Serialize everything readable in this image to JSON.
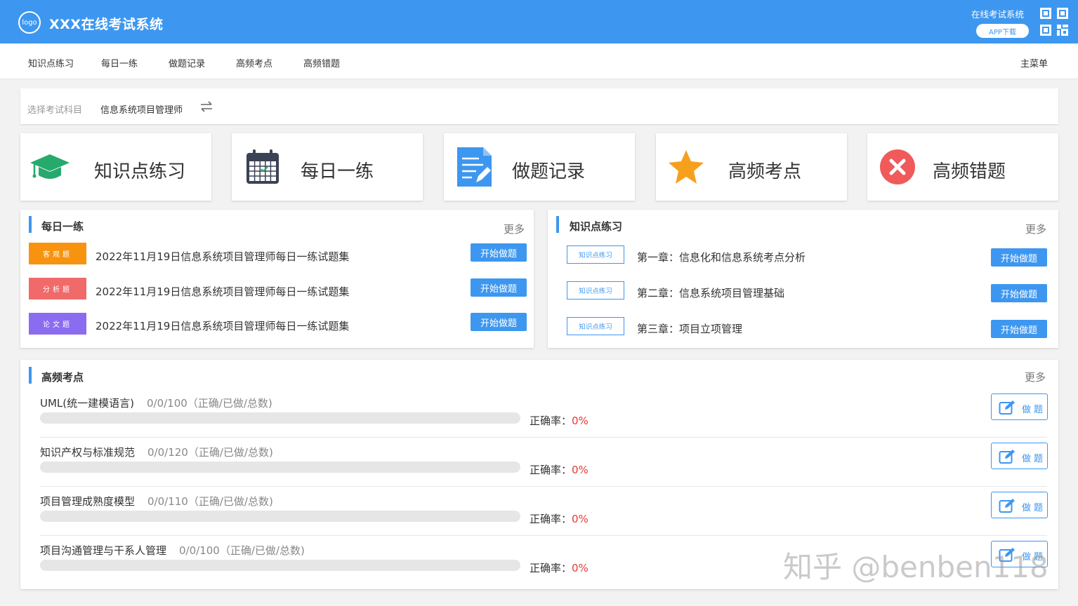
{
  "header": {
    "logo_text": "logo",
    "title": "XXX在线考试系统",
    "system_label": "在线考试系统",
    "app_download": "APP下载",
    "colors": {
      "primary": "#3d97f0",
      "white": "#ffffff"
    }
  },
  "nav": {
    "items": [
      "知识点练习",
      "每日一练",
      "做题记录",
      "高频考点",
      "高频错题"
    ],
    "main_menu": "主菜单"
  },
  "subject": {
    "label": "选择考试科目",
    "value": "信息系统项目管理师",
    "swap_icon": "swap-icon"
  },
  "tiles": [
    {
      "label": "知识点练习",
      "icon": "graduation-cap-icon",
      "color": "#26a96c"
    },
    {
      "label": "每日一练",
      "icon": "calendar-icon",
      "color": "#3a4256"
    },
    {
      "label": "做题记录",
      "icon": "document-edit-icon",
      "color": "#3d97f0"
    },
    {
      "label": "高频考点",
      "icon": "star-icon",
      "color": "#f7a01e"
    },
    {
      "label": "高频错题",
      "icon": "error-circle-icon",
      "color": "#f05a5a"
    }
  ],
  "daily": {
    "title": "每日一练",
    "more": "更多",
    "rows": [
      {
        "tag": "客观题",
        "tag_color": "#f7930e",
        "text": "2022年11月19日信息系统项目管理师每日一练试题集",
        "button": "开始做题"
      },
      {
        "tag": "分析题",
        "tag_color": "#f06a6a",
        "text": "2022年11月19日信息系统项目管理师每日一练试题集",
        "button": "开始做题"
      },
      {
        "tag": "论文题",
        "tag_color": "#8a6cf0",
        "text": "2022年11月19日信息系统项目管理师每日一练试题集",
        "button": "开始做题"
      }
    ]
  },
  "knowledge": {
    "title": "知识点练习",
    "more": "更多",
    "rows": [
      {
        "tag": "知识点练习",
        "text": "第一章：信息化和信息系统考点分析",
        "button": "开始做题"
      },
      {
        "tag": "知识点练习",
        "text": "第二章：信息系统项目管理基础",
        "button": "开始做题"
      },
      {
        "tag": "知识点练习",
        "text": "第三章：项目立项管理",
        "button": "开始做题"
      }
    ]
  },
  "highfreq": {
    "title": "高频考点",
    "more": "更多",
    "rate_label": "正确率：",
    "button": "做题",
    "rows": [
      {
        "name": "UML(统一建模语言)",
        "stat": "0/0/100（正确/已做/总数)",
        "rate": "0%",
        "progress": 0
      },
      {
        "name": "知识产权与标准规范",
        "stat": "0/0/120（正确/已做/总数)",
        "rate": "0%",
        "progress": 0
      },
      {
        "name": "项目管理成熟度模型",
        "stat": "0/0/110（正确/已做/总数)",
        "rate": "0%",
        "progress": 0
      },
      {
        "name": "项目沟通管理与干系人管理",
        "stat": "0/0/100（正确/已做/总数)",
        "rate": "0%",
        "progress": 0
      }
    ]
  },
  "watermark": "知乎 @benben118"
}
